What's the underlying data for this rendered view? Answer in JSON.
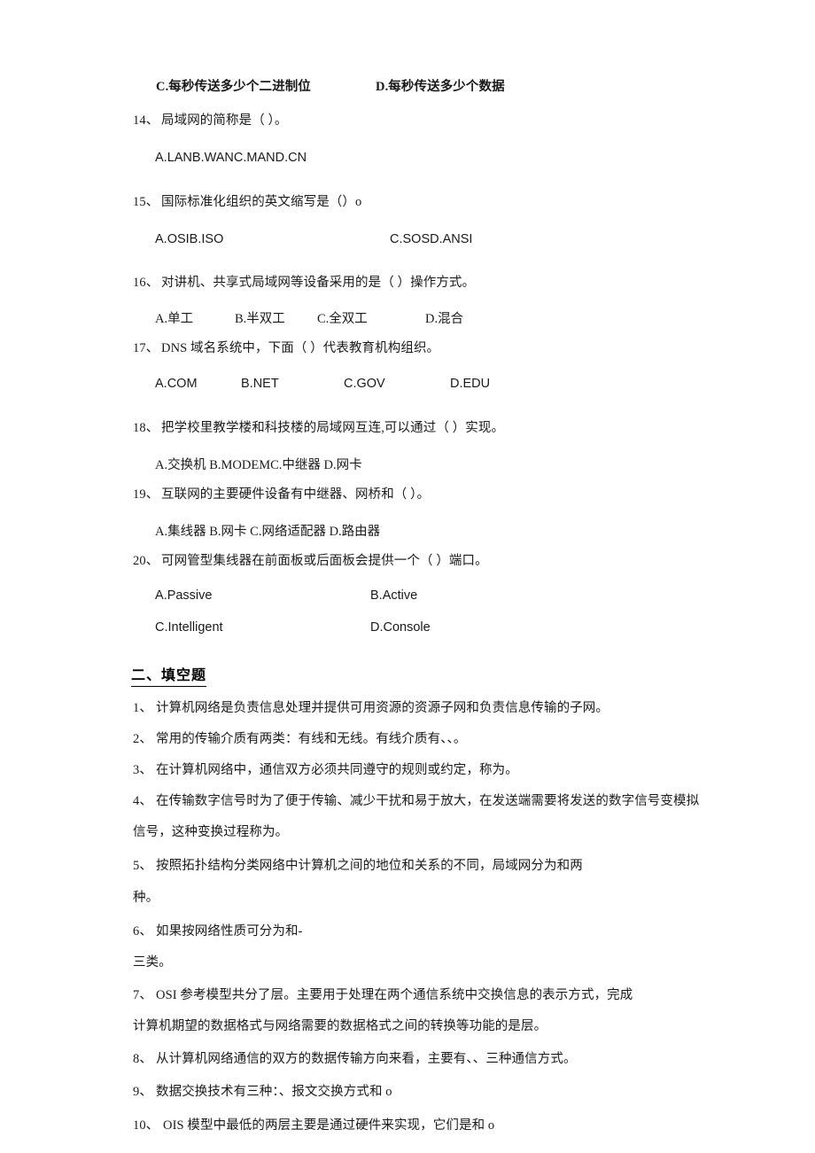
{
  "document": {
    "type": "exam-paper",
    "language": "zh-CN",
    "page_background": "#ffffff",
    "text_color": "#1a1a1a"
  },
  "top_partial_question": {
    "option_c": "C.每秒传送多少个二进制位",
    "option_d": "D.每秒传送多少个数据"
  },
  "choice_questions": [
    {
      "number": "14、",
      "stem": "局域网的简称是（                ）。",
      "options_inline": "A.LANB.WANC.MAND.CN"
    },
    {
      "number": "15、",
      "stem": "国际标准化组织的英文缩写是（）o",
      "option_left": "A.OSIB.ISO",
      "option_right": "C.SOSD.ANSI"
    },
    {
      "number": "16、",
      "stem": "对讲机、共享式局域网等设备采用的是（            ）操作方式。",
      "options": [
        "A.单工",
        "B.半双工",
        "C.全双工",
        "D.混合"
      ]
    },
    {
      "number": "17、",
      "stem": "DNS 域名系统中，下面（          ）代表教育机构组织。",
      "options": [
        "A.COM",
        "B.NET",
        "C.GOV",
        "D.EDU"
      ]
    },
    {
      "number": "18、",
      "stem": "把学校里教学楼和科技楼的局域网互连,可以通过（          ）实现。",
      "options_inline": "A.交换机 B.MODEMC.中继器 D.网卡"
    },
    {
      "number": "19、",
      "stem": "互联网的主要硬件设备有中继器、网桥和（            ）。",
      "options_inline": "A.集线器 B.网卡 C.网络适配器 D.路由器"
    },
    {
      "number": "20、",
      "stem": "可网管型集线器在前面板或后面板会提供一个（         ）端口。",
      "option_a": "A.Passive",
      "option_b": "B.Active",
      "option_c": "C.Intelligent",
      "option_d": "D.Console"
    }
  ],
  "section_two": {
    "title": "二、填空题",
    "questions": [
      {
        "number": "1、",
        "lines": [
          "计算机网络是负责信息处理并提供可用资源的资源子网和负责信息传输的子网。"
        ]
      },
      {
        "number": "2、",
        "lines": [
          "常用的传输介质有两类：有线和无线。有线介质有、、。"
        ]
      },
      {
        "number": "3、",
        "lines": [
          "在计算机网络中，通信双方必须共同遵守的规则或约定，称为。"
        ]
      },
      {
        "number": "4、",
        "lines": [
          "在传输数字信号时为了便于传输、减少干扰和易于放大，在发送端需要将发送的数字信号变模拟",
          "信号，这种变换过程称为。"
        ]
      },
      {
        "number": "5、",
        "lines": [
          "按照拓扑结构分类网络中计算机之间的地位和关系的不同，局域网分为和两",
          "种。"
        ]
      },
      {
        "number": "6、",
        "lines": [
          "如果按网络性质可分为和-",
          "三类。"
        ]
      },
      {
        "number": "7、",
        "lines": [
          "OSI 参考模型共分了层。主要用于处理在两个通信系统中交换信息的表示方式，完成",
          "计算机期望的数据格式与网络需要的数据格式之间的转换等功能的是层。"
        ]
      },
      {
        "number": "8、",
        "lines": [
          "从计算机网络通信的双方的数据传输方向来看，主要有、、三种通信方式。"
        ]
      },
      {
        "number": "9、",
        "lines": [
          "数据交换技术有三种：、报文交换方式和 o"
        ]
      },
      {
        "number": "10、",
        "lines": [
          "OIS 模型中最低的两层主要是通过硬件来实现，它们是和 o"
        ]
      }
    ]
  }
}
